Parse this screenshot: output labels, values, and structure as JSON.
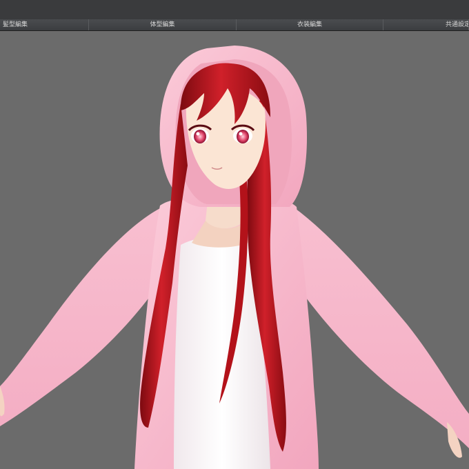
{
  "tabs": [
    {
      "label": "髪型編集"
    },
    {
      "label": "体型編集"
    },
    {
      "label": "衣装編集"
    },
    {
      "label": "共通設定"
    }
  ],
  "viewport": {
    "subject": "anime-character-avatar",
    "colors": {
      "background": "#6b6b6b",
      "hoodie": "#f7b9cc",
      "hair": "#b3121a",
      "shirt": "#ffffff",
      "eyes": "#e0456a",
      "skin": "#fbe5d4"
    }
  }
}
